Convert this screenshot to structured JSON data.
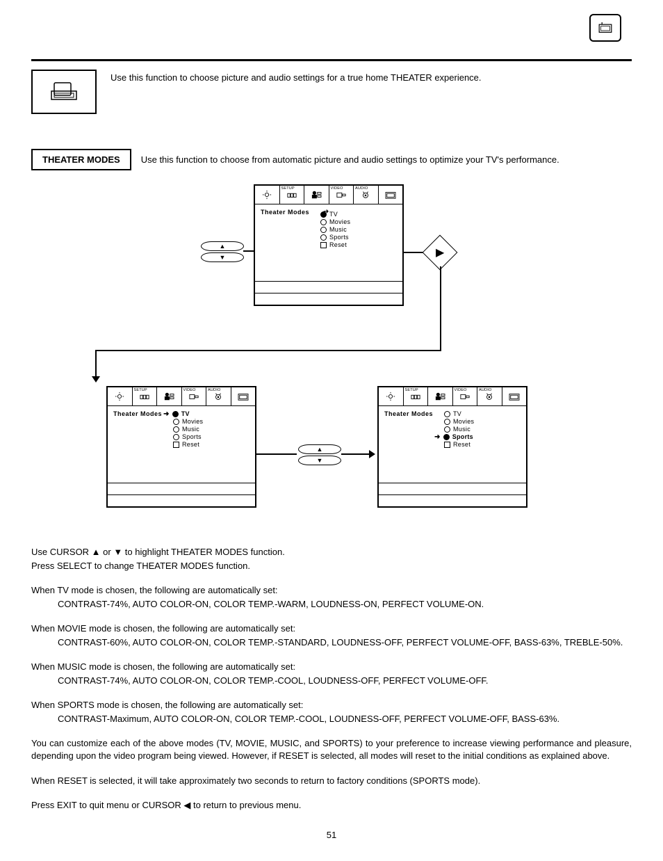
{
  "header": {
    "top_icon": "theater-icon"
  },
  "intro": {
    "text": "Use this function to choose picture and audio settings for a true home THEATER experience."
  },
  "section": {
    "label": "THEATER MODES",
    "text": "Use this function to choose from automatic picture and audio settings to optimize your TV's performance."
  },
  "osd_tabs": {
    "setup": "SETUP",
    "video": "VIDEO",
    "audio": "AUDIO"
  },
  "osd_panels": {
    "main": {
      "title": "Theater Modes",
      "options": {
        "tv": "TV",
        "movies": "Movies",
        "music": "Music",
        "sports": "Sports",
        "reset": "Reset"
      },
      "selected": "tv",
      "arrow_at": "title"
    },
    "left": {
      "title": "Theater Modes",
      "options": {
        "tv": "TV",
        "movies": "Movies",
        "music": "Music",
        "sports": "Sports",
        "reset": "Reset"
      },
      "selected": "tv",
      "arrow_at": "tv",
      "bold": "tv"
    },
    "right": {
      "title": "Theater Modes",
      "options": {
        "tv": "TV",
        "movies": "Movies",
        "music": "Music",
        "sports": "Sports",
        "reset": "Reset"
      },
      "selected": "sports",
      "arrow_at": "sports",
      "bold": "sports"
    }
  },
  "body": {
    "p1a": "Use CURSOR ▲ or ▼ to highlight THEATER  MODES function.",
    "p1b": "Press SELECT to change THEATER MODES function.",
    "tv_head": "When TV mode is chosen, the following are automatically set:",
    "tv_vals": "CONTRAST-74%, AUTO COLOR-ON, COLOR TEMP.-WARM, LOUDNESS-ON, PERFECT VOLUME-ON.",
    "movie_head": "When MOVIE mode is chosen, the following are automatically set:",
    "movie_vals": "CONTRAST-60%, AUTO COLOR-ON, COLOR TEMP.-STANDARD, LOUDNESS-OFF, PERFECT VOLUME-OFF, BASS-63%, TREBLE-50%.",
    "music_head": "When MUSIC mode is chosen, the following are automatically set:",
    "music_vals": "CONTRAST-74%, AUTO COLOR-ON, COLOR TEMP.-COOL, LOUDNESS-OFF, PERFECT VOLUME-OFF.",
    "sports_head": "When SPORTS mode is chosen, the following are automatically set:",
    "sports_vals": "CONTRAST-Maximum, AUTO COLOR-ON, COLOR TEMP.-COOL, LOUDNESS-OFF, PERFECT VOLUME-OFF, BASS-63%.",
    "custom": "You can customize each of the above modes (TV, MOVIE, MUSIC, and SPORTS) to your preference to increase viewing performance and pleasure, depending upon the video program being viewed. However, if RESET is selected, all modes will reset to the initial conditions as explained above.",
    "reset": "When RESET is selected, it will take approximately two seconds to return to factory conditions (SPORTS mode).",
    "exit": "Press EXIT to quit menu or CURSOR ◀ to return to previous menu."
  },
  "page_number": "51"
}
